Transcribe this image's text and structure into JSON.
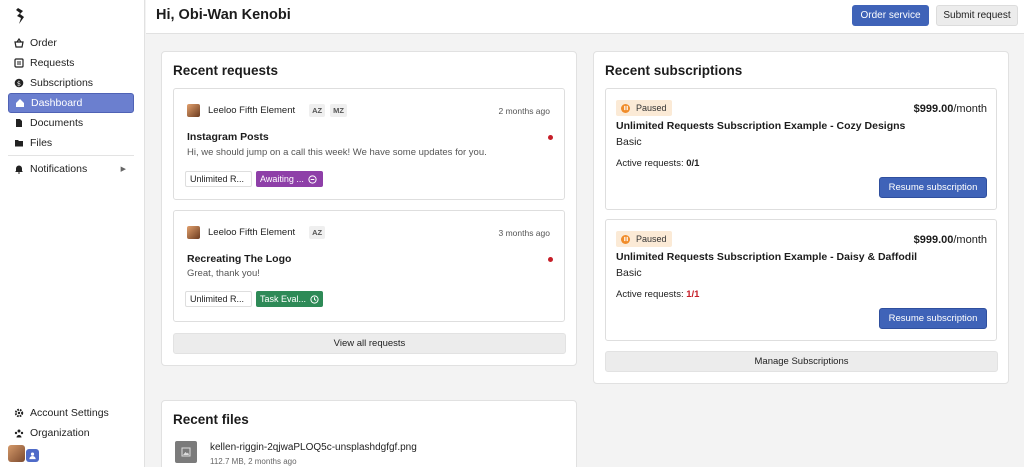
{
  "sidebar": {
    "items": [
      {
        "label": "Order",
        "icon": "basket-icon"
      },
      {
        "label": "Requests",
        "icon": "list-icon"
      },
      {
        "label": "Subscriptions",
        "icon": "coin-icon"
      },
      {
        "label": "Dashboard",
        "icon": "home-icon",
        "active": true
      },
      {
        "label": "Documents",
        "icon": "document-icon"
      },
      {
        "label": "Files",
        "icon": "folder-icon"
      },
      {
        "label": "Notifications",
        "icon": "bell-icon"
      }
    ],
    "bottom": [
      {
        "label": "Account Settings",
        "icon": "gear-icon"
      },
      {
        "label": "Organization",
        "icon": "team-icon"
      }
    ]
  },
  "header": {
    "greeting": "Hi, Obi-Wan Kenobi",
    "order_label": "Order service",
    "submit_label": "Submit request"
  },
  "requests": {
    "title": "Recent requests",
    "items": [
      {
        "author": "Leeloo Fifth Element",
        "initials": [
          "AZ",
          "MZ"
        ],
        "time": "2 months ago",
        "title": "Instagram Posts",
        "body": "Hi, we should jump on a call this week! We have some updates for you.",
        "plan": "Unlimited R...",
        "status": "Awaiting ...",
        "status_color": "#8e3fa8"
      },
      {
        "author": "Leeloo Fifth Element",
        "initials": [
          "AZ"
        ],
        "time": "3 months ago",
        "title": "Recreating The Logo",
        "body": "Great, thank you!",
        "plan": "Unlimited R...",
        "status": "Task Eval...",
        "status_color": "#2e8a57"
      }
    ],
    "view_all_label": "View all requests"
  },
  "subscriptions": {
    "title": "Recent subscriptions",
    "items": [
      {
        "status": "Paused",
        "price": "$999.00",
        "period": "/month",
        "name": "Unlimited Requests Subscription Example - Cozy Designs",
        "plan": "Basic",
        "active_label": "Active requests:",
        "active_value": "0/1",
        "active_used": "0",
        "active_total": "/1",
        "resume_label": "Resume subscription"
      },
      {
        "status": "Paused",
        "price": "$999.00",
        "period": "/month",
        "name": "Unlimited Requests Subscription Example - Daisy & Daffodil",
        "plan": "Basic",
        "active_label": "Active requests:",
        "active_used": "1",
        "active_total": "/1",
        "resume_label": "Resume subscription"
      }
    ],
    "manage_label": "Manage Subscriptions"
  },
  "files": {
    "title": "Recent files",
    "items": [
      {
        "name": "kellen-riggin-2qjwaPLOQ5c-unsplashdgfgf.png",
        "meta": "112.7 MB, 2 months ago"
      }
    ]
  },
  "colors": {
    "accent": "#3f63b8",
    "active_nav": "#6b7fcf",
    "alert_dot": "#c61e28",
    "paused": "#f08c2a"
  }
}
